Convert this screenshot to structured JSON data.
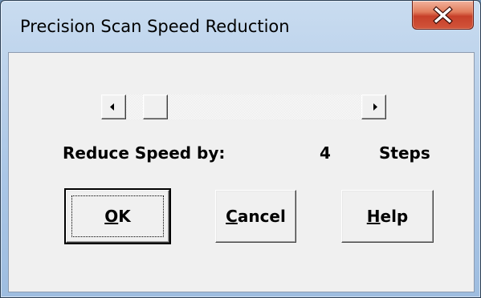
{
  "window": {
    "title": "Precision Scan Speed Reduction"
  },
  "titlebar": {
    "close_icon": "close-icon"
  },
  "scrollbar": {
    "left_icon": "arrow-left-icon",
    "right_icon": "arrow-right-icon",
    "position_fraction": 0.08
  },
  "reduce": {
    "label": "Reduce Speed by:",
    "value": "4",
    "unit": "Steps"
  },
  "buttons": {
    "ok": {
      "mnemonic": "O",
      "rest": "K"
    },
    "cancel": {
      "mnemonic": "C",
      "rest": "ancel"
    },
    "help": {
      "mnemonic": "H",
      "rest": "elp"
    }
  },
  "colors": {
    "close_red": "#c7402a",
    "dialog_face": "#f0f0f0",
    "frame_blue": "#aac6e6"
  }
}
